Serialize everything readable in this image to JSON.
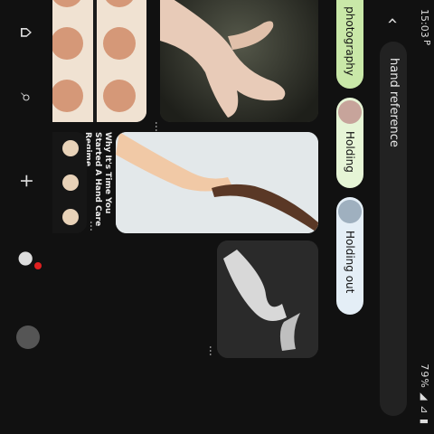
{
  "status": {
    "time": "15:03",
    "notif": "P",
    "right": "79% ◢ ⊿ ▮"
  },
  "search": {
    "query": "hand reference"
  },
  "chips": [
    "photography",
    "Holding",
    "Holding out"
  ],
  "pins": [
    {
      "caption": ""
    },
    {
      "caption": "Why It's Time You Started A Hand Care Regime"
    },
    {
      "caption": ""
    },
    {
      "caption": ""
    },
    {
      "caption": ""
    }
  ],
  "icons": {
    "back": "back-arrow-icon",
    "home": "home-icon",
    "search": "search-icon",
    "create": "plus-icon",
    "notifications": "speech-bubble-icon",
    "profile": "avatar"
  },
  "colors": {
    "background": "#111111",
    "chip_green": "#c9e8a8",
    "chip_light": "#e6f5d6",
    "chip_blue": "#e4eef6",
    "badge": "#e02020"
  }
}
